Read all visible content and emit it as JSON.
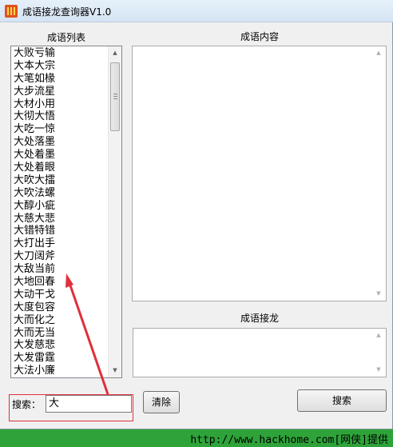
{
  "window": {
    "title": "成语接龙查询器V1.0"
  },
  "list_panel": {
    "heading": "成语列表",
    "items": [
      "大败亏输",
      "大本大宗",
      "大笔如椽",
      "大步流星",
      "大材小用",
      "大彻大悟",
      "大吃一惊",
      "大处落墨",
      "大处着墨",
      "大处着眼",
      "大吹大擂",
      "大吹法螺",
      "大醇小疵",
      "大慈大悲",
      "大错特错",
      "大打出手",
      "大刀阔斧",
      "大敌当前",
      "大地回春",
      "大动干戈",
      "大度包容",
      "大而化之",
      "大而无当",
      "大发慈悲",
      "大发雷霆",
      "大法小廉"
    ]
  },
  "content_panel": {
    "heading": "成语内容",
    "text": ""
  },
  "chain_panel": {
    "heading": "成语接龙",
    "text": ""
  },
  "search": {
    "label": "搜索：",
    "value": "大"
  },
  "buttons": {
    "clear": "清除",
    "search": "搜索"
  },
  "footer": {
    "text": "http://www.hackhome.com[网侠]提供"
  },
  "colors": {
    "annotation_arrow": "#e0303a",
    "footer_bar": "#2ea33a",
    "app_icon": "#e0521d"
  }
}
